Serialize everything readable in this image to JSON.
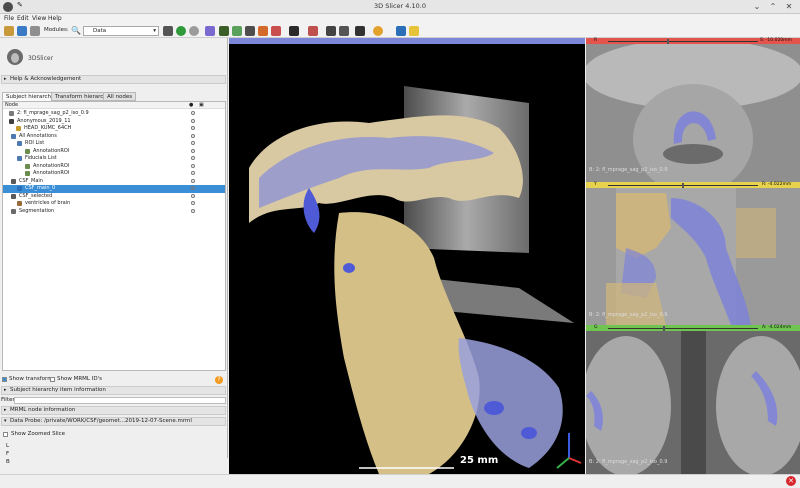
{
  "window": {
    "title": "3D Slicer 4.10.0"
  },
  "menu": [
    "File",
    "Edit",
    "View",
    "Help"
  ],
  "toolbar": {
    "modules_label": "Modules:",
    "module_value": "Data"
  },
  "brand": {
    "name": "3DSlicer"
  },
  "sections": {
    "help": "Help & Acknowledgement",
    "subject_info": "Subject hierarchy item information",
    "mrml": "MRML node information",
    "data_probe": "Data Probe: /private/WORK/CSF/geomet...2019-12-07-Scene.mrml"
  },
  "tabs": [
    "Subject hierarchy",
    "Transform hierarchy",
    "All nodes"
  ],
  "tree": {
    "header": "Node",
    "rows": [
      {
        "label": "2: fl_mprage_sag_p2_iso_0.9",
        "indent": 2,
        "color": "#7a7a7a",
        "sel": false
      },
      {
        "label": "Anonymous_2019_11",
        "indent": 2,
        "color": "#3f3f3f",
        "sel": false
      },
      {
        "label": "HEAD_KUMC_64CH",
        "indent": 9,
        "color": "#c49a2a",
        "sel": false
      },
      {
        "label": "All Annotations",
        "indent": 4,
        "color": "#4d79b3",
        "sel": false
      },
      {
        "label": "ROI List",
        "indent": 10,
        "color": "#4d79b3",
        "sel": false
      },
      {
        "label": "AnnotationROI",
        "indent": 18,
        "color": "#6b8e4e",
        "sel": false
      },
      {
        "label": "Fiducials List",
        "indent": 10,
        "color": "#4d79b3",
        "sel": false
      },
      {
        "label": "AnnotationROI",
        "indent": 18,
        "color": "#6b8e4e",
        "sel": false
      },
      {
        "label": "AnnotationROI",
        "indent": 18,
        "color": "#6b8e4e",
        "sel": false
      },
      {
        "label": "CSF_Main",
        "indent": 4,
        "color": "#5a5a5a",
        "sel": false
      },
      {
        "label": "CSF_main_0",
        "indent": 10,
        "color": "#2a6fb7",
        "sel": true
      },
      {
        "label": "CSF_selected",
        "indent": 4,
        "color": "#5a5a5a",
        "sel": false
      },
      {
        "label": "ventricles of brain",
        "indent": 10,
        "color": "#9a6a3a",
        "sel": false
      },
      {
        "label": "Segmentation",
        "indent": 4,
        "color": "#6a6a6a",
        "sel": false
      }
    ]
  },
  "options": {
    "show_transforms": "Show transforms",
    "show_mrml_ids": "Show MRML ID's",
    "filter_label": "Filter:",
    "show_zoomed_slice": "Show Zoomed Slice",
    "probe_lines": [
      "L",
      "F",
      "B"
    ]
  },
  "views": {
    "threed_scale": "25 mm",
    "red": {
      "left": "R",
      "right": "S: -10.020mm",
      "label": "B: 2: fl_mprage_sag_p2_iso_0.9"
    },
    "yellow": {
      "left": "Y",
      "right": "R: -4.022mm",
      "label": "B: 2: fl_mprage_sag_p2_iso_0.9"
    },
    "green": {
      "left": "G",
      "right": "A: -4.024mm",
      "label": "B: 2: fl_mprage_sag_p2_iso_0.9"
    }
  },
  "colors": {
    "selection": "#3a8ed6",
    "red_view": "#e4544c",
    "yellow_view": "#e6d24c",
    "green_view": "#6fc54f",
    "threed_view": "#7c86d8",
    "csf_overlay": "#7f86e0",
    "tissue_overlay": "#d9c28c"
  }
}
